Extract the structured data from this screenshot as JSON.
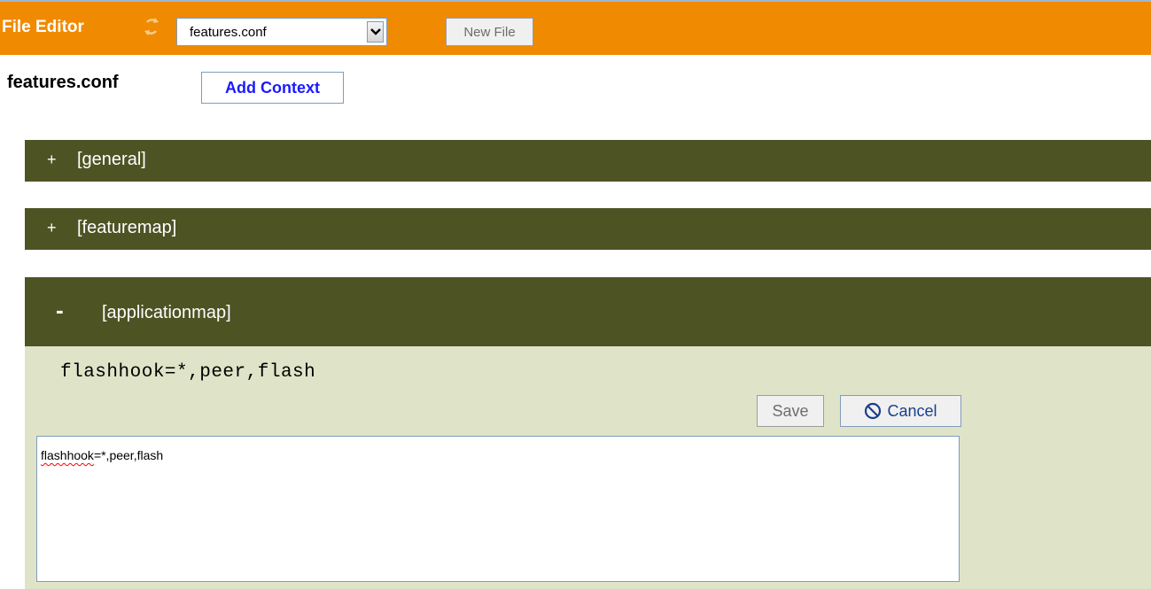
{
  "header": {
    "title": "File Editor",
    "file_select": {
      "selected": "features.conf"
    },
    "new_file_label": "New File",
    "accent_color": "#f08a00"
  },
  "file": {
    "name": "features.conf",
    "add_context_label": "Add Context"
  },
  "contexts": [
    {
      "toggle": "+",
      "name": "[general]",
      "expanded": false
    },
    {
      "toggle": "+",
      "name": "[featuremap]",
      "expanded": false
    },
    {
      "toggle": "-",
      "name": "[applicationmap]",
      "expanded": true
    }
  ],
  "applicationmap": {
    "preview_line": "flashhook=*,peer,flash",
    "save_label": "Save",
    "cancel_label": "Cancel",
    "editor_word1": "flashhook",
    "editor_rest": "=*,peer,flash"
  },
  "colors": {
    "section_header_bg": "#4e5324",
    "section_body_bg": "#dfe4c8",
    "link_blue": "#1a1aff"
  }
}
